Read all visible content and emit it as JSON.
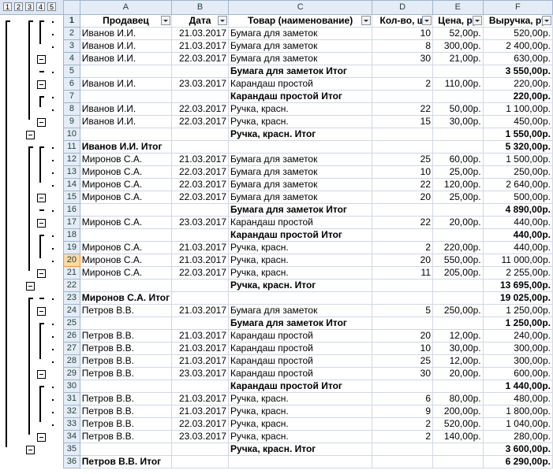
{
  "outline_levels": [
    "1",
    "2",
    "3",
    "4",
    "5"
  ],
  "column_letters": [
    "A",
    "B",
    "C",
    "D",
    "E",
    "F"
  ],
  "field_headers": [
    "Продавец",
    "Дата",
    "Товар (наименование)",
    "Кол-во, ш",
    "Цена, ру",
    "Выручка, ру"
  ],
  "active_row": "20",
  "rows": [
    {
      "n": "2",
      "a": "Иванов И.И.",
      "b": "21.03.2017",
      "c": "Бумага для заметок",
      "d": "10",
      "e": "52,00р.",
      "f": "520,00р."
    },
    {
      "n": "3",
      "a": "Иванов И.И.",
      "b": "21.03.2017",
      "c": "Бумага для заметок",
      "d": "8",
      "e": "300,00р.",
      "f": "2 400,00р."
    },
    {
      "n": "4",
      "a": "Иванов И.И.",
      "b": "22.03.2017",
      "c": "Бумага для заметок",
      "d": "30",
      "e": "21,00р.",
      "f": "630,00р."
    },
    {
      "n": "5",
      "a": "",
      "b": "",
      "c": "Бумага для заметок Итог",
      "d": "",
      "e": "",
      "f": "3 550,00р.",
      "bold": true
    },
    {
      "n": "6",
      "a": "Иванов И.И.",
      "b": "23.03.2017",
      "c": "Карандаш простой",
      "d": "2",
      "e": "110,00р.",
      "f": "220,00р."
    },
    {
      "n": "7",
      "a": "",
      "b": "",
      "c": "Карандаш простой Итог",
      "d": "",
      "e": "",
      "f": "220,00р.",
      "bold": true
    },
    {
      "n": "8",
      "a": "Иванов И.И.",
      "b": "22.03.2017",
      "c": "Ручка, красн.",
      "d": "22",
      "e": "50,00р.",
      "f": "1 100,00р."
    },
    {
      "n": "9",
      "a": "Иванов И.И.",
      "b": "22.03.2017",
      "c": "Ручка, красн.",
      "d": "15",
      "e": "30,00р.",
      "f": "450,00р."
    },
    {
      "n": "10",
      "a": "",
      "b": "",
      "c": "Ручка, красн. Итог",
      "d": "",
      "e": "",
      "f": "1 550,00р.",
      "bold": true
    },
    {
      "n": "11",
      "a": "Иванов И.И. Итог",
      "b": "",
      "c": "",
      "d": "",
      "e": "",
      "f": "5 320,00р.",
      "bold": true
    },
    {
      "n": "12",
      "a": "Миронов С.А.",
      "b": "21.03.2017",
      "c": "Бумага для заметок",
      "d": "25",
      "e": "60,00р.",
      "f": "1 500,00р."
    },
    {
      "n": "13",
      "a": "Миронов С.А.",
      "b": "22.03.2017",
      "c": "Бумага для заметок",
      "d": "10",
      "e": "25,00р.",
      "f": "250,00р."
    },
    {
      "n": "14",
      "a": "Миронов С.А.",
      "b": "22.03.2017",
      "c": "Бумага для заметок",
      "d": "22",
      "e": "120,00р.",
      "f": "2 640,00р."
    },
    {
      "n": "15",
      "a": "Миронов С.А.",
      "b": "22.03.2017",
      "c": "Бумага для заметок",
      "d": "20",
      "e": "25,00р.",
      "f": "500,00р."
    },
    {
      "n": "16",
      "a": "",
      "b": "",
      "c": "Бумага для заметок Итог",
      "d": "",
      "e": "",
      "f": "4 890,00р.",
      "bold": true
    },
    {
      "n": "17",
      "a": "Миронов С.А.",
      "b": "23.03.2017",
      "c": "Карандаш простой",
      "d": "22",
      "e": "20,00р.",
      "f": "440,00р."
    },
    {
      "n": "18",
      "a": "",
      "b": "",
      "c": "Карандаш простой Итог",
      "d": "",
      "e": "",
      "f": "440,00р.",
      "bold": true
    },
    {
      "n": "19",
      "a": "Миронов С.А.",
      "b": "21.03.2017",
      "c": "Ручка, красн.",
      "d": "2",
      "e": "220,00р.",
      "f": "440,00р."
    },
    {
      "n": "20",
      "a": "Миронов С.А.",
      "b": "21.03.2017",
      "c": "Ручка, красн.",
      "d": "20",
      "e": "550,00р.",
      "f": "11 000,00р."
    },
    {
      "n": "21",
      "a": "Миронов С.А.",
      "b": "22.03.2017",
      "c": "Ручка, красн.",
      "d": "11",
      "e": "205,00р.",
      "f": "2 255,00р."
    },
    {
      "n": "22",
      "a": "",
      "b": "",
      "c": "Ручка, красн. Итог",
      "d": "",
      "e": "",
      "f": "13 695,00р.",
      "bold": true
    },
    {
      "n": "23",
      "a": "Миронов С.А. Итог",
      "b": "",
      "c": "",
      "d": "",
      "e": "",
      "f": "19 025,00р.",
      "bold": true
    },
    {
      "n": "24",
      "a": "Петров В.В.",
      "b": "21.03.2017",
      "c": "Бумага для заметок",
      "d": "5",
      "e": "250,00р.",
      "f": "1 250,00р."
    },
    {
      "n": "25",
      "a": "",
      "b": "",
      "c": "Бумага для заметок Итог",
      "d": "",
      "e": "",
      "f": "1 250,00р.",
      "bold": true
    },
    {
      "n": "26",
      "a": "Петров В.В.",
      "b": "21.03.2017",
      "c": "Карандаш простой",
      "d": "20",
      "e": "12,00р.",
      "f": "240,00р."
    },
    {
      "n": "27",
      "a": "Петров В.В.",
      "b": "21.03.2017",
      "c": "Карандаш простой",
      "d": "10",
      "e": "30,00р.",
      "f": "300,00р."
    },
    {
      "n": "28",
      "a": "Петров В.В.",
      "b": "21.03.2017",
      "c": "Карандаш простой",
      "d": "25",
      "e": "12,00р.",
      "f": "300,00р."
    },
    {
      "n": "29",
      "a": "Петров В.В.",
      "b": "23.03.2017",
      "c": "Карандаш простой",
      "d": "30",
      "e": "20,00р.",
      "f": "600,00р."
    },
    {
      "n": "30",
      "a": "",
      "b": "",
      "c": "Карандаш простой Итог",
      "d": "",
      "e": "",
      "f": "1 440,00р.",
      "bold": true
    },
    {
      "n": "31",
      "a": "Петров В.В.",
      "b": "21.03.2017",
      "c": "Ручка, красн.",
      "d": "6",
      "e": "80,00р.",
      "f": "480,00р."
    },
    {
      "n": "32",
      "a": "Петров В.В.",
      "b": "21.03.2017",
      "c": "Ручка, красн.",
      "d": "9",
      "e": "200,00р.",
      "f": "1 800,00р."
    },
    {
      "n": "33",
      "a": "Петров В.В.",
      "b": "22.03.2017",
      "c": "Ручка, красн.",
      "d": "2",
      "e": "520,00р.",
      "f": "1 040,00р."
    },
    {
      "n": "34",
      "a": "Петров В.В.",
      "b": "23.03.2017",
      "c": "Ручка, красн.",
      "d": "2",
      "e": "140,00р.",
      "f": "280,00р."
    },
    {
      "n": "35",
      "a": "",
      "b": "",
      "c": "Ручка, красн. Итог",
      "d": "",
      "e": "",
      "f": "3 600,00р.",
      "bold": true
    },
    {
      "n": "36",
      "a": "Петров В.В. Итог",
      "b": "",
      "c": "",
      "d": "",
      "e": "",
      "f": "6 290,00р.",
      "bold": true
    }
  ],
  "outline_icons": {
    "collapse": "minus-box-icon",
    "detail": "dot-icon"
  }
}
